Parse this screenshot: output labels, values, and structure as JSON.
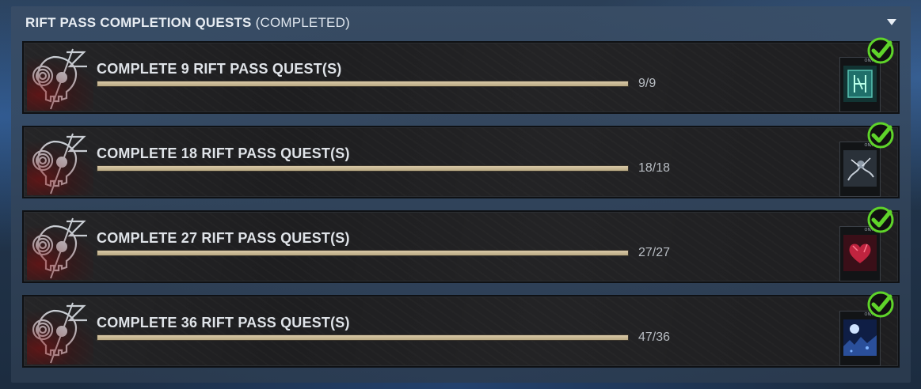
{
  "header": {
    "title": "RIFT PASS COMPLETION QUESTS",
    "status": "(COMPLETED)"
  },
  "quests": [
    {
      "name": "COMPLETE 9 RIFT PASS QUEST(S)",
      "count": "9/9",
      "progress": 1.0,
      "reward_icon": "teal-glyph-charm",
      "reward_color": "#1f6f6a",
      "reward_tag": "ON/REJ"
    },
    {
      "name": "COMPLETE 18 RIFT PASS QUEST(S)",
      "count": "18/18",
      "progress": 1.0,
      "reward_icon": "grey-creature-charm",
      "reward_color": "#5c6a78",
      "reward_tag": "ON/REJ"
    },
    {
      "name": "COMPLETE 27 RIFT PASS QUEST(S)",
      "count": "27/27",
      "progress": 1.0,
      "reward_icon": "red-heart-charm",
      "reward_color": "#a0203a",
      "reward_tag": "ON/REJ"
    },
    {
      "name": "COMPLETE 36 RIFT PASS QUEST(S)",
      "count": "47/36",
      "progress": 1.0,
      "reward_icon": "blue-night-charm",
      "reward_color": "#2a4f9a",
      "reward_tag": "ON/REJ"
    }
  ],
  "colors": {
    "check_green": "#5fd42a",
    "progress_fill": "#d2c29f"
  }
}
